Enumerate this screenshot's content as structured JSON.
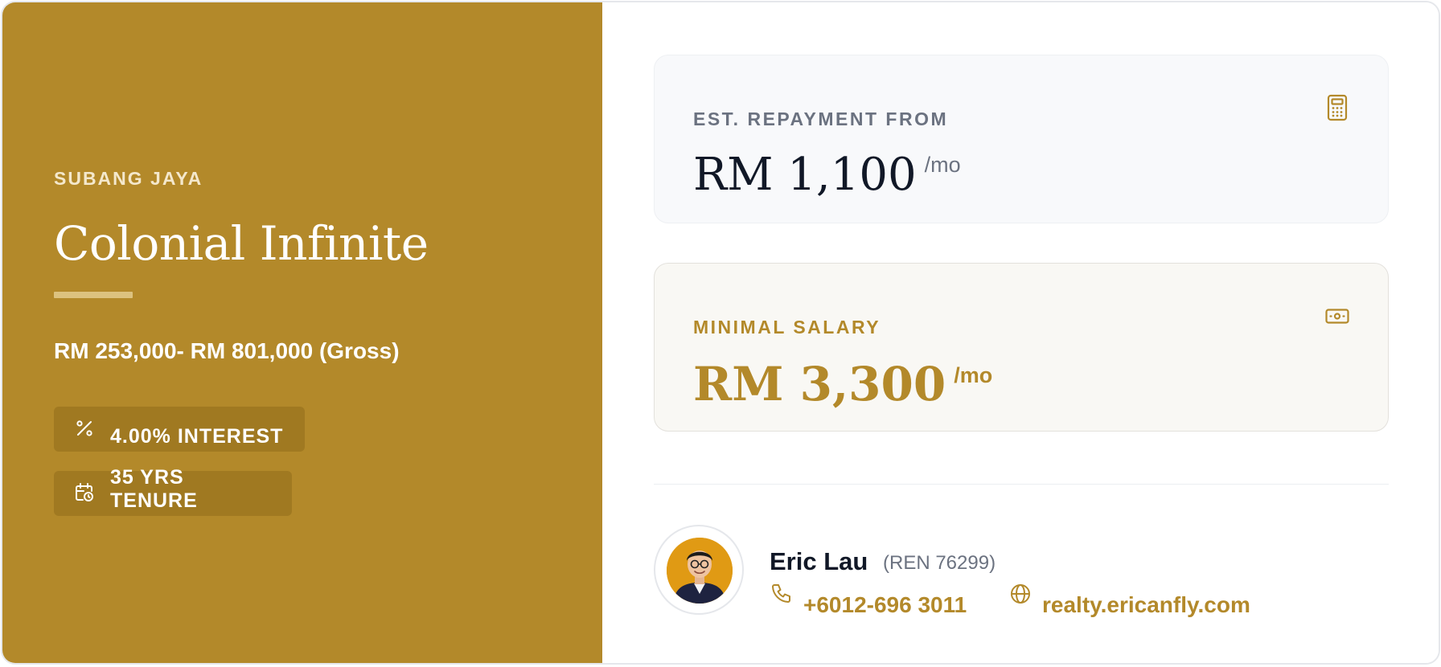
{
  "colors": {
    "accent": "#b3892a",
    "dark_text": "#111827",
    "muted_text": "#6b7280"
  },
  "property": {
    "location": "SUBANG JAYA",
    "name": "Colonial Infinite",
    "price_range": "RM 253,000- RM 801,000 (Gross)",
    "interest": {
      "icon": "percent-icon",
      "label": "4.00% INTEREST"
    },
    "tenure": {
      "icon": "calendar-clock-icon",
      "label": "35 YRS TENURE"
    }
  },
  "repayment": {
    "label": "EST. REPAYMENT FROM",
    "amount": "RM 1,100",
    "period": "/mo",
    "icon": "calculator-icon"
  },
  "salary": {
    "label": "MINIMAL SALARY",
    "amount": "RM 3,300",
    "period": "/mo",
    "icon": "banknote-icon"
  },
  "agent": {
    "name": "Eric Lau",
    "ren": "(REN 76299)",
    "phone": "+6012-696 3011",
    "phone_icon": "phone-icon",
    "website": "realty.ericanfly.com",
    "website_icon": "globe-icon"
  }
}
